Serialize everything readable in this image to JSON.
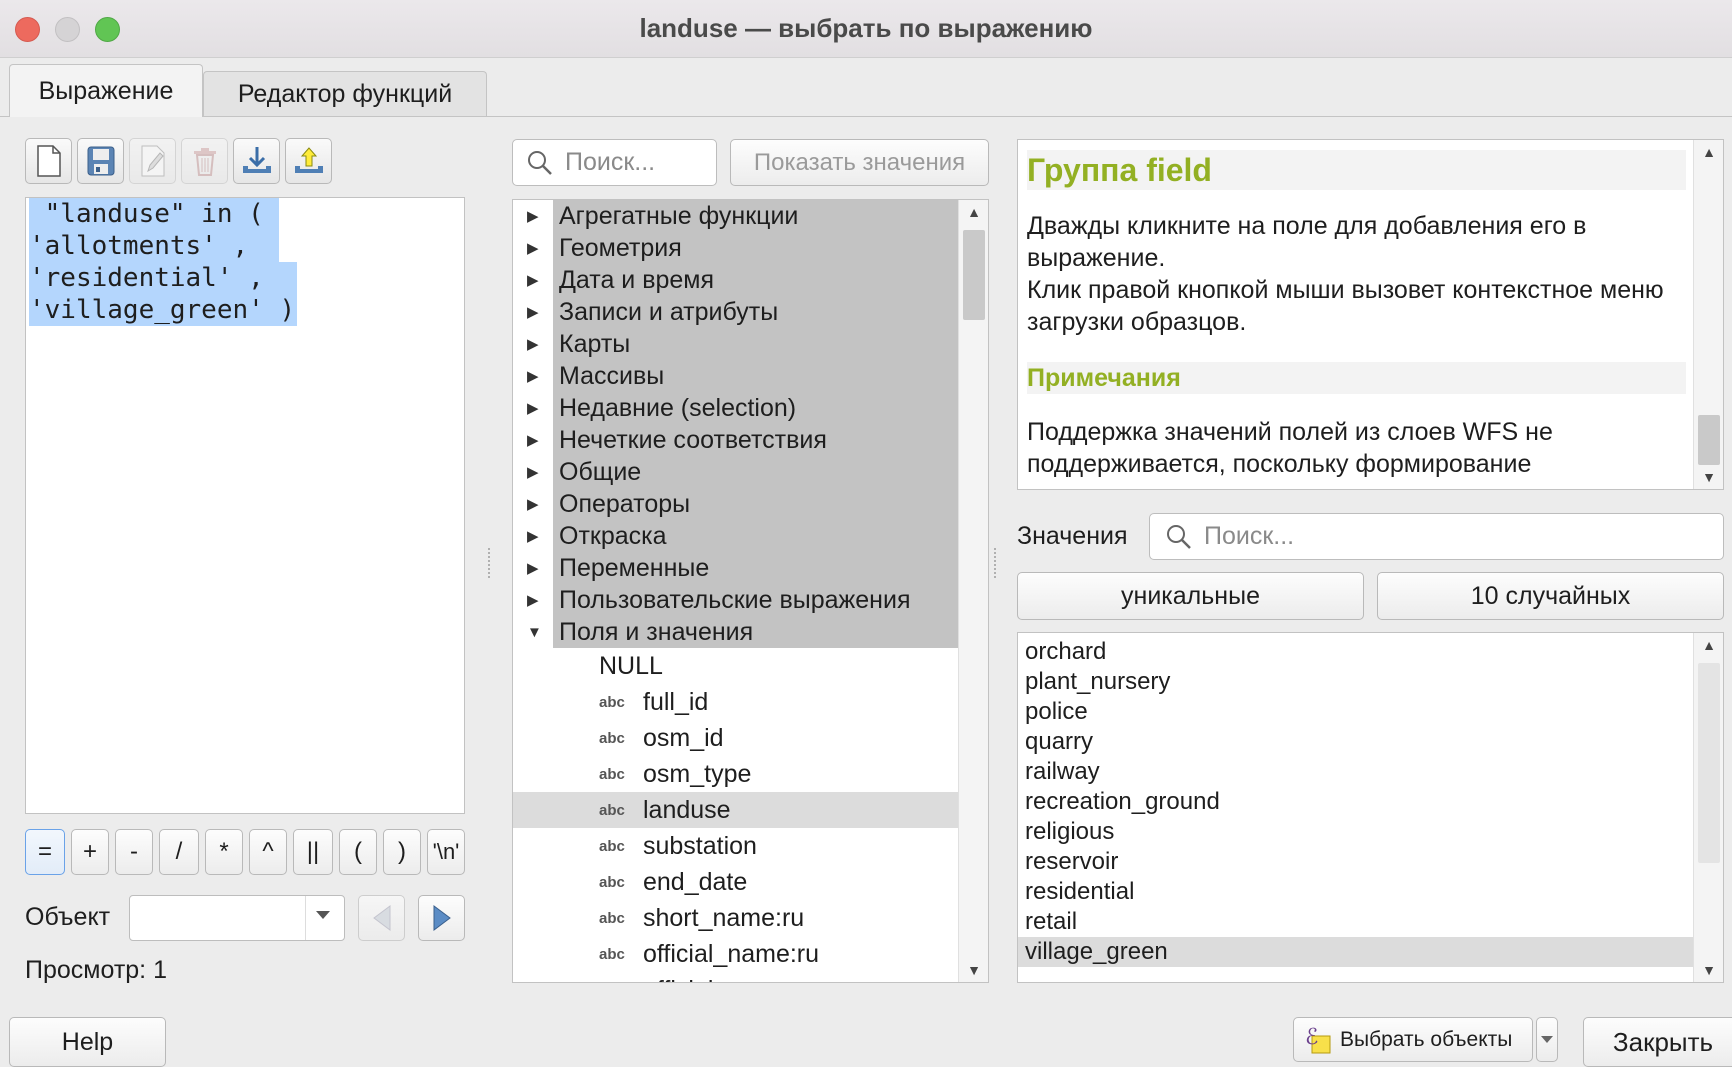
{
  "window": {
    "title": "landuse — выбрать по выражению"
  },
  "tabs": [
    {
      "label": "Выражение",
      "active": true
    },
    {
      "label": "Редактор функций",
      "active": false
    }
  ],
  "toolbar": {
    "icons": [
      "new-file-icon",
      "save-icon",
      "edit-icon",
      "delete-icon",
      "import-icon",
      "export-icon"
    ]
  },
  "editor": {
    "lines": [
      " \"landuse\" in (",
      "'allotments' ,",
      "'residential' ,",
      "'village_green' )"
    ]
  },
  "operators": [
    "=",
    "+",
    "-",
    "/",
    "*",
    "^",
    "||",
    "(",
    ")",
    "'\\n'"
  ],
  "object": {
    "label": "Объект",
    "value": ""
  },
  "preview": {
    "label": "Просмотр:",
    "value": "1"
  },
  "middle": {
    "search_placeholder": "Поиск...",
    "show_values_label": "Показать значения",
    "groups": [
      "Агрегатные функции",
      "Геометрия",
      "Дата и время",
      "Записи и атрибуты",
      "Карты",
      "Массивы",
      "Недавние (selection)",
      "Нечеткие соответствия",
      "Общие",
      "Операторы",
      "Откраска",
      "Переменные",
      "Пользовательские выражения",
      "Поля и значения"
    ],
    "null_item": "NULL",
    "type_badge": "abc",
    "fields": [
      "full_id",
      "osm_id",
      "osm_type",
      "landuse",
      "substation",
      "end_date",
      "short_name:ru",
      "official_name:ru",
      "official_name:en"
    ],
    "selected_field": "landuse"
  },
  "info": {
    "heading": "Группа field",
    "text1": "Дважды кликните на поле для добавления его в выражение.",
    "text2": "Клик правой кнопкой мыши вызовет контекстное меню загрузки образцов.",
    "notes_heading": "Примечания",
    "text3": "Поддержка значений полей из слоев WFS не поддерживается, поскольку формирование"
  },
  "values": {
    "label": "Значения",
    "search_placeholder": "Поиск...",
    "unique_label": "уникальные",
    "random_label": "10 случайных",
    "items": [
      "orchard",
      "plant_nursery",
      "police",
      "quarry",
      "railway",
      "recreation_ground",
      "religious",
      "reservoir",
      "residential",
      "retail",
      "village_green"
    ],
    "selected": "village_green"
  },
  "footer": {
    "help_label": "Help",
    "select_label": "Выбрать объекты",
    "close_label": "Закрыть"
  },
  "colors": {
    "accent_green": "#93b023",
    "selection": "#b4d6fd"
  }
}
